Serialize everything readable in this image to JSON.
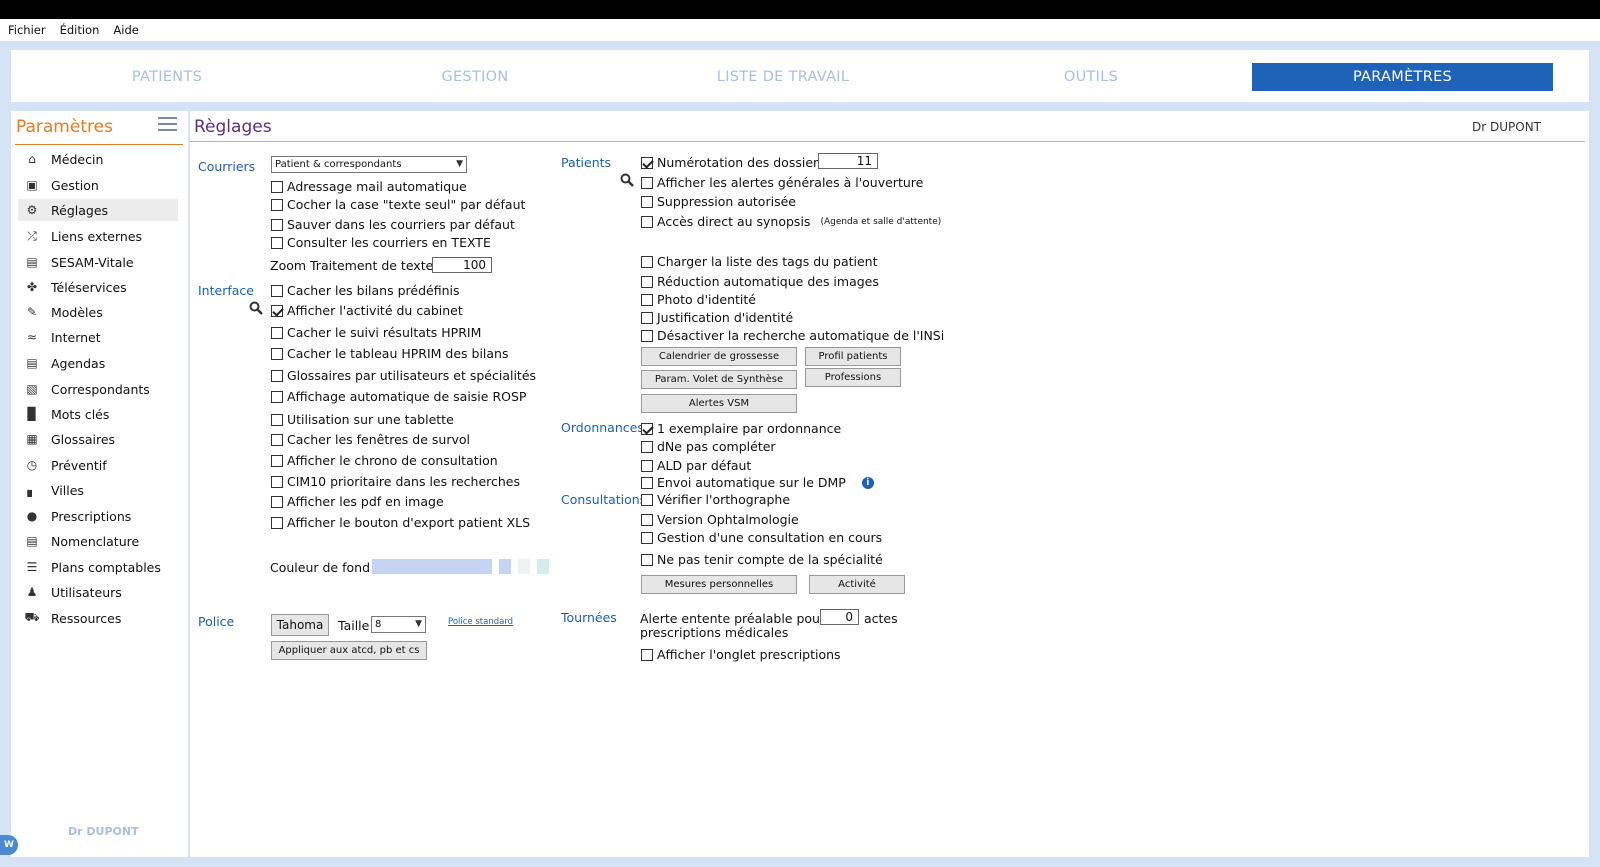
{
  "menubar": {
    "items": [
      "Fichier",
      "Édition",
      "Aide"
    ]
  },
  "nav": {
    "tabs": [
      "PATIENTS",
      "GESTION",
      "LISTE DE TRAVAIL",
      "OUTILS",
      "PARAMÈTRES"
    ],
    "active": "PARAMÈTRES"
  },
  "sidebar": {
    "title": "Paramètres",
    "items": [
      "Médecin",
      "Gestion",
      "Réglages",
      "Liens externes",
      "SESAM-Vitale",
      "Téléservices",
      "Modèles",
      "Internet",
      "Agendas",
      "Correspondants",
      "Mots clés",
      "Glossaires",
      "Préventif",
      "Villes",
      "Prescriptions",
      "Nomenclature",
      "Plans comptables",
      "Utilisateurs",
      "Ressources"
    ],
    "selected": "Réglages",
    "footer": "Dr DUPONT"
  },
  "main": {
    "title": "Règlages",
    "doctor": "Dr DUPONT",
    "courriers": {
      "label": "Courriers",
      "select_value": "Patient & correspondants",
      "options": [
        {
          "label": "Adressage mail automatique",
          "checked": false
        },
        {
          "label": "Cocher la case \"texte seul\" par défaut",
          "checked": false
        },
        {
          "label": "Sauver dans les courriers par défaut",
          "checked": false
        },
        {
          "label": "Consulter les courriers en TEXTE",
          "checked": false
        }
      ],
      "zoom_label": "Zoom Traitement de texte",
      "zoom_value": "100"
    },
    "interface": {
      "label": "Interface",
      "options": [
        {
          "label": "Cacher les bilans prédéfinis",
          "checked": false
        },
        {
          "label": "Afficher l'activité du cabinet",
          "checked": true
        },
        {
          "label": "Cacher le suivi résultats HPRIM",
          "checked": false
        },
        {
          "label": "Cacher le tableau HPRIM des bilans",
          "checked": false
        },
        {
          "label": "Glossaires par utilisateurs et spécialités",
          "checked": false
        },
        {
          "label": "Affichage automatique de saisie ROSP",
          "checked": false
        },
        {
          "label": "Utilisation sur une tablette",
          "checked": false
        },
        {
          "label": "Cacher les fenêtres de survol",
          "checked": false
        },
        {
          "label": "Afficher le chrono de consultation",
          "checked": false
        },
        {
          "label": "CIM10 prioritaire dans les recherches",
          "checked": false
        },
        {
          "label": "Afficher les pdf en image",
          "checked": false
        },
        {
          "label": "Afficher le bouton d'export patient XLS",
          "checked": false
        }
      ],
      "couleur_label": "Couleur de fond",
      "swatch_colors": [
        "#c5d4f2",
        "#c5d4f2",
        "#f0f2f4",
        "#d4ecec"
      ]
    },
    "police": {
      "label": "Police",
      "font_button": "Tahoma",
      "taille_label": "Taille",
      "taille_value": "8",
      "standard_link": "Police standard",
      "apply_button": "Appliquer aux atcd, pb et cs"
    },
    "patients": {
      "label": "Patients",
      "options": [
        {
          "label": "Numérotation des dossiers",
          "checked": true
        },
        {
          "label": "Afficher les alertes générales à l'ouverture",
          "checked": false
        },
        {
          "label": "Suppression autorisée",
          "checked": false
        },
        {
          "label": "Accès direct au synopsis",
          "checked": false
        },
        {
          "label": "Charger la liste des tags du patient",
          "checked": false
        },
        {
          "label": "Réduction automatique des images",
          "checked": false
        },
        {
          "label": "Photo d'identité",
          "checked": false
        },
        {
          "label": "Justification d'identité",
          "checked": false
        },
        {
          "label": "Désactiver la recherche automatique de l'INSi",
          "checked": false
        }
      ],
      "numerotation_value": "11",
      "synopsis_note": "(Agenda et salle d'attente)",
      "buttons": [
        "Calendrier de grossesse",
        "Profil patients",
        "Param. Volet de Synthèse",
        "Professions",
        "Alertes VSM"
      ]
    },
    "ordonnances": {
      "label": "Ordonnances",
      "options": [
        {
          "label": "1 exemplaire par ordonnance",
          "checked": true
        },
        {
          "label": "dNe pas compléter",
          "checked": false
        },
        {
          "label": "ALD par défaut",
          "checked": false
        },
        {
          "label": "Envoi automatique sur le DMP",
          "checked": false
        }
      ]
    },
    "consultations": {
      "label": "Consultations",
      "options": [
        {
          "label": "Vérifier l'orthographe",
          "checked": false
        },
        {
          "label": "Version Ophtalmologie",
          "checked": false
        },
        {
          "label": "Gestion d'une consultation en cours",
          "checked": false
        },
        {
          "label": "Ne pas tenir compte de la spécialité",
          "checked": false
        }
      ],
      "buttons": [
        "Mesures personnelles",
        "Activité"
      ]
    },
    "tournees": {
      "label": "Tournées",
      "alerte_prefix": "Alerte entente préalable pour les",
      "alerte_value": "0",
      "alerte_suffix": "actes",
      "alerte_line2": "prescriptions médicales",
      "option": {
        "label": "Afficher l'onglet prescriptions",
        "checked": false
      }
    }
  },
  "colors": {
    "accent": "#1e63b8",
    "sidebar_title": "#e77b22",
    "main_title": "#5c2e85",
    "section_label": "#1e5fae",
    "background": "#d6e2f6"
  },
  "icons": [
    "search-icon",
    "info-icon",
    "hamburger-icon",
    "chevron-down-icon"
  ]
}
